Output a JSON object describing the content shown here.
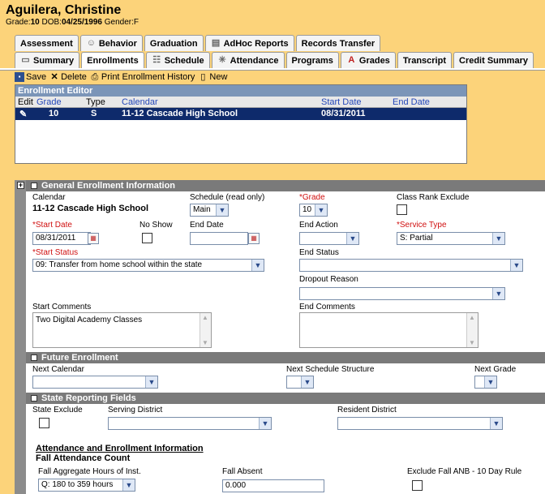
{
  "student": {
    "name": "Aguilera, Christine",
    "grade_label": "Grade:",
    "grade": "10",
    "dob_label": "DOB:",
    "dob": "04/25/1996",
    "gender_label": "Gender:",
    "gender": "F"
  },
  "tabs_top": [
    {
      "label": "Assessment",
      "icon": ""
    },
    {
      "label": "Behavior",
      "icon": "behavior-icon"
    },
    {
      "label": "Graduation",
      "icon": ""
    },
    {
      "label": "AdHoc Reports",
      "icon": "report-icon"
    },
    {
      "label": "Records Transfer",
      "icon": ""
    }
  ],
  "tabs_bottom": [
    {
      "label": "Summary",
      "icon": "summary-icon"
    },
    {
      "label": "Enrollments",
      "icon": ""
    },
    {
      "label": "Schedule",
      "icon": "schedule-icon"
    },
    {
      "label": "Attendance",
      "icon": "attendance-icon"
    },
    {
      "label": "Programs",
      "icon": ""
    },
    {
      "label": "Grades",
      "icon": "grades-icon"
    },
    {
      "label": "Transcript",
      "icon": ""
    },
    {
      "label": "Credit Summary",
      "icon": ""
    }
  ],
  "toolbar": {
    "save": "Save",
    "delete": "Delete",
    "print": "Print Enrollment History",
    "new": "New"
  },
  "editor": {
    "title": "Enrollment Editor",
    "columns": [
      "Edit",
      "Grade",
      "Type",
      "Calendar",
      "Start Date",
      "End Date"
    ],
    "rows": [
      {
        "grade": "10",
        "type": "S",
        "calendar": "11-12 Cascade High School",
        "start": "08/31/2011",
        "end": ""
      }
    ]
  },
  "general": {
    "title": "General Enrollment Information",
    "calendar_label": "Calendar",
    "calendar_value": "11-12 Cascade High School",
    "schedule_label": "Schedule (read only)",
    "schedule_value": "Main",
    "grade_label": "*Grade",
    "grade_value": "10",
    "class_rank_label": "Class Rank Exclude",
    "start_date_label": "*Start Date",
    "start_date_value": "08/31/2011",
    "no_show_label": "No Show",
    "end_date_label": "End Date",
    "end_date_value": "",
    "end_action_label": "End Action",
    "end_action_value": "",
    "service_type_label": "*Service Type",
    "service_type_value": "S: Partial",
    "start_status_label": "*Start Status",
    "start_status_value": "09: Transfer from home school within the state",
    "end_status_label": "End Status",
    "end_status_value": "",
    "dropout_label": "Dropout Reason",
    "dropout_value": "",
    "start_comments_label": "Start Comments",
    "start_comments_value": "Two Digital Academy Classes",
    "end_comments_label": "End Comments",
    "end_comments_value": ""
  },
  "future": {
    "title": "Future Enrollment",
    "next_calendar_label": "Next Calendar",
    "next_schedule_label": "Next Schedule Structure",
    "next_grade_label": "Next Grade"
  },
  "state": {
    "title": "State Reporting Fields",
    "exclude_label": "State Exclude",
    "serving_label": "Serving District",
    "resident_label": "Resident District",
    "attendance_heading": "Attendance and Enrollment Information",
    "fall_count_heading": "Fall Attendance Count",
    "fall_hours_label": "Fall Aggregate Hours of Inst.",
    "fall_hours_value": "Q: 180 to 359 hours",
    "fall_absent_label": "Fall Absent",
    "fall_absent_value": "0.000",
    "exclude_fall_label": "Exclude Fall ANB - 10 Day Rule"
  }
}
